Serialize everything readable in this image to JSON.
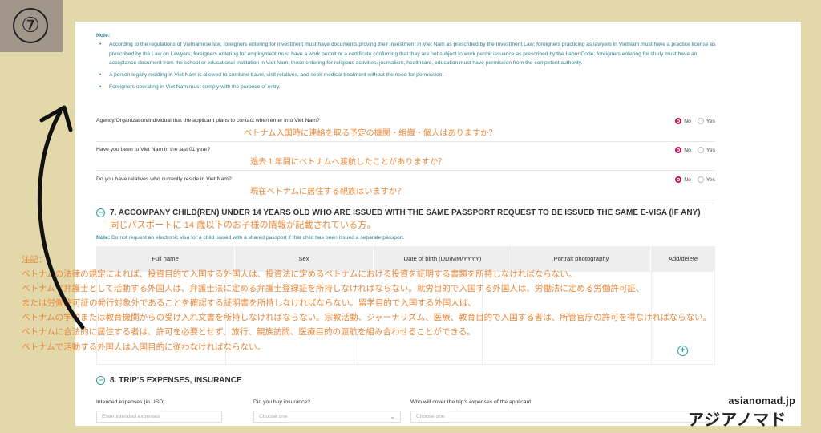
{
  "step": {
    "number": "⑦"
  },
  "note": {
    "title": "Note:",
    "items": [
      "According to the regulations of Vietnamese law, foreigners entering for investment must have documents proving their investment in Viet Nam as prescribed by the Investment Law; foreigners practicing as lawyers in VietNam must have a practice license as prescribed by the Law on Lawyers; foreigners entering for employment must have a work permit or a certificate confirming that they are not subject to work permit issuance as prescribed by the Labor Code; foreigners entering for study must have an acceptance document from the school or educational institution in Viet Nam; those entering for religious activities, journalism, healthcare, education must have permission from the competent authority.",
      "A person legally residing in Viet Nam is allowed to combine travel, visit relatives, and seek medical treatment without the need for permission.",
      "Foreigners operating in Viet Nam must comply with the purpose of entry."
    ]
  },
  "questions": [
    {
      "label": "Agency/Organization/Individual that the applicant plans to contact when enter into Viet Nam?",
      "jp": "ベトナム入国時に連絡を取る予定の機関・組織・個人はありますか？",
      "no": "No",
      "yes": "Yes"
    },
    {
      "label": "Have you been to Viet Nam in the last 01 year?",
      "jp": "過去１年間にベトナムへ渡航したことがありますか？",
      "no": "No",
      "yes": "Yes"
    },
    {
      "label": "Do you have relatives who currently reside in Viet Nam?",
      "jp": "現在ベトナムに居住する親族はいますか？",
      "no": "No",
      "yes": "Yes"
    }
  ],
  "section7": {
    "title": "7. ACCOMPANY CHILD(REN) UNDER 14 YEARS OLD WHO ARE ISSUED WITH THE SAME PASSPORT REQUEST TO BE ISSUED THE SAME E-VISA (IF ANY)",
    "jp": "同じパスポートに 14 歳以下のお子様の情報が記載されている方。",
    "note_label": "Note:",
    "note_text": "Do not request an electronic visa for a child issued with a shared passport if that child has been issued a separate passport.",
    "columns": [
      "Full name",
      "Sex",
      "Date of birth (DD/MM/YYYY)",
      "Portrait photography",
      "Add/delete"
    ]
  },
  "overlay_jp": [
    "注記：",
    "ベトナムの法律の規定によれば、投資目的で入国する外国人は、投資法に定めるベトナムにおける投資を証明する書類を所持しなければならない。",
    "ベトナムで弁護士として活動する外国人は、弁護士法に定める弁護士登録証を所持しなければならない。就労目的で入国する外国人は、労働法に定める労働許可証、",
    "または労働許可証の発行対象外であることを確認する証明書を所持しなければならない。留学目的で入国する外国人は、",
    "ベトナムの学校または教育機関からの受け入れ文書を所持しなければならない。宗教活動、ジャーナリズム、医療、教育目的で入国する者は、所管官庁の許可を得なければならない。",
    "ベトナムに合法的に居住する者は、許可を必要とせず、旅行、親族訪問、医療目的の渡航を組み合わせることができる。",
    "ベトナムで活動する外国人は入国目的に従わなければならない。"
  ],
  "section8": {
    "title": "8. TRIP'S EXPENSES, INSURANCE",
    "fields": [
      {
        "label": "Intended expenses (in USD)",
        "placeholder": "Enter intended expenses"
      },
      {
        "label": "Did you buy insurance?",
        "placeholder": "Choose one"
      },
      {
        "label": "Who will cover the trip's expenses of the applicant",
        "placeholder": "Choose one"
      }
    ]
  },
  "brand": {
    "url": "asianomad.jp",
    "kana": "アジアノマド"
  },
  "colors": {
    "background": "#e2d8a9",
    "note_teal": "#2b7f8e",
    "annotation_orange": "#e8883a",
    "radio_selected": "#c2185b",
    "accent_teal": "#2aa19a"
  }
}
